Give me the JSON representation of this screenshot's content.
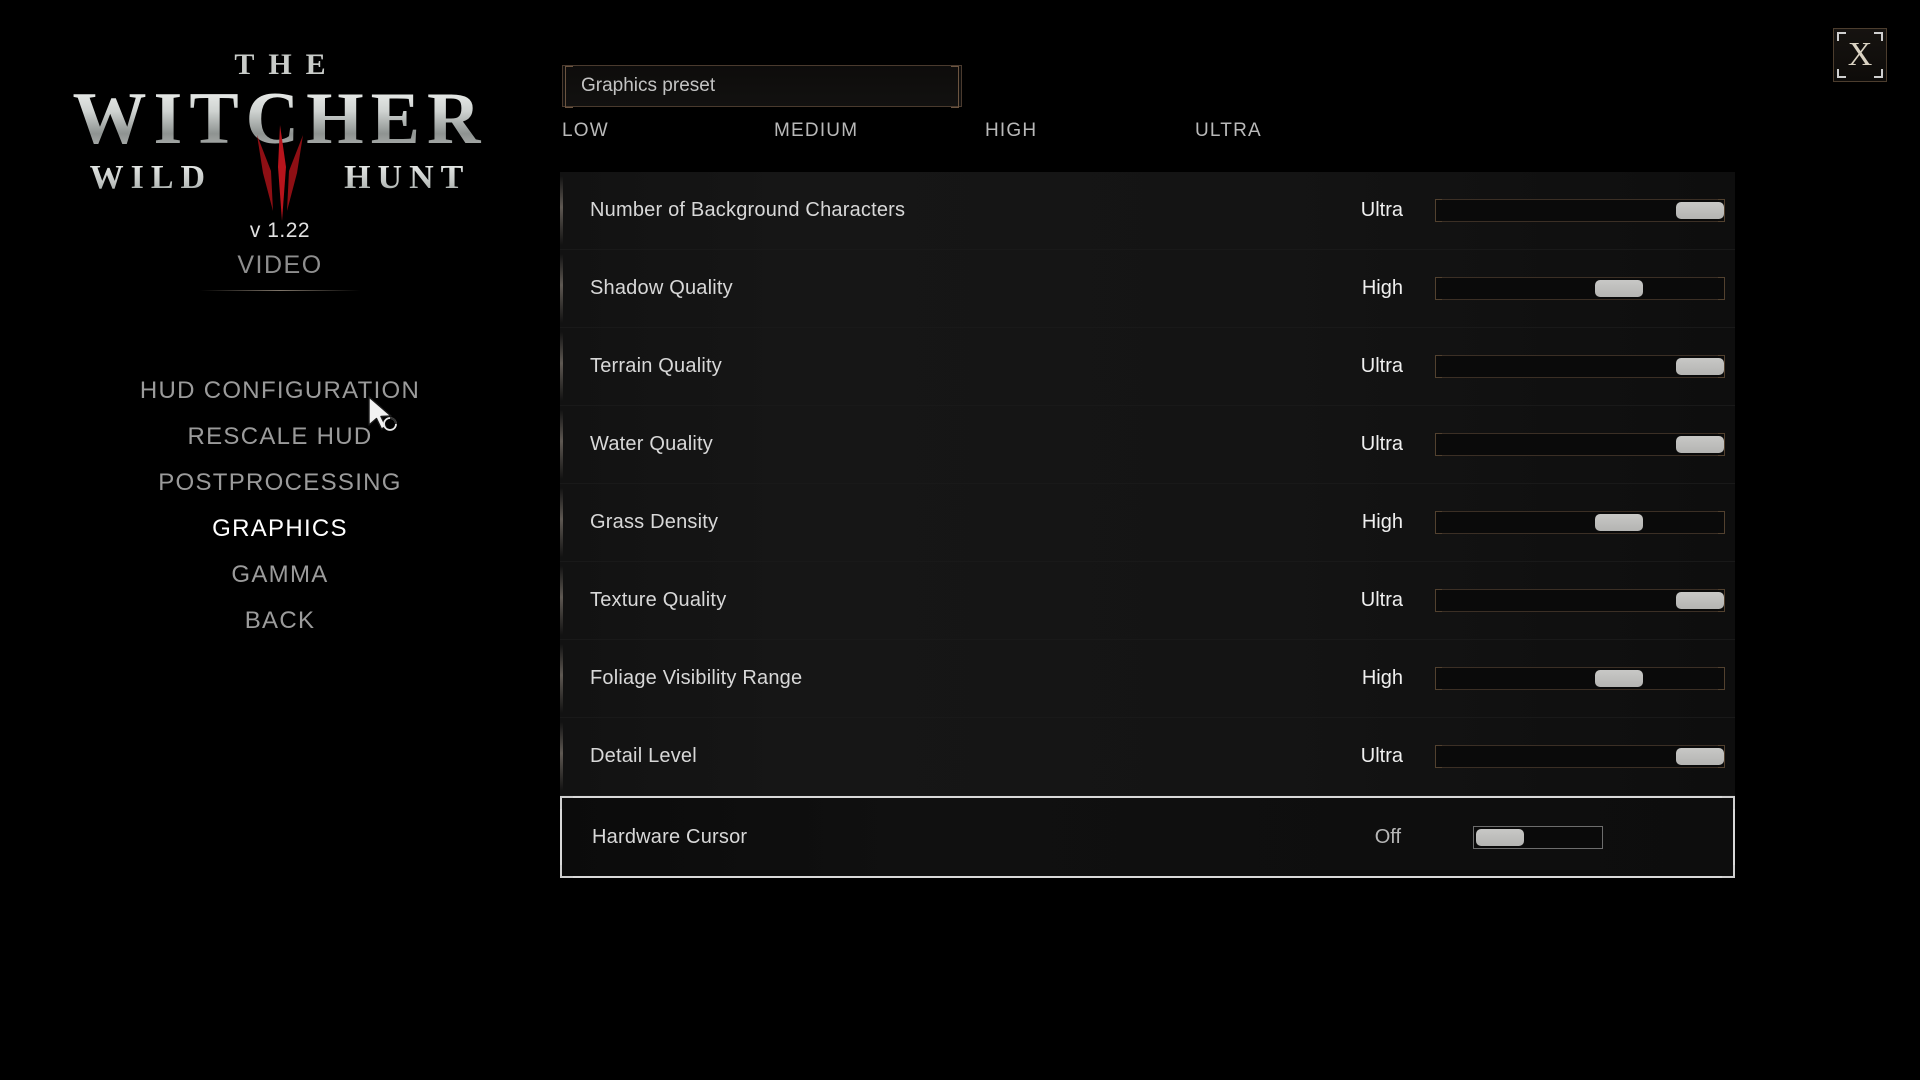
{
  "branding": {
    "title_the": "THE",
    "title_main": "WITCHER",
    "title_wild": "WILD",
    "title_hunt": "HUNT",
    "version": "v 1.22",
    "section": "VIDEO"
  },
  "menu": {
    "items": [
      {
        "label": "HUD CONFIGURATION",
        "active": false
      },
      {
        "label": "RESCALE HUD",
        "active": false
      },
      {
        "label": "POSTPROCESSING",
        "active": false
      },
      {
        "label": "GRAPHICS",
        "active": true
      },
      {
        "label": "GAMMA",
        "active": false
      },
      {
        "label": "BACK",
        "active": false
      }
    ]
  },
  "preset": {
    "label": "Graphics preset",
    "options": [
      "LOW",
      "MEDIUM",
      "HIGH",
      "ULTRA"
    ]
  },
  "settings": {
    "rows": [
      {
        "name": "Number of Background Characters",
        "value": "Ultra",
        "fill": 100
      },
      {
        "name": "Shadow Quality",
        "value": "High",
        "fill": 66
      },
      {
        "name": "Terrain Quality",
        "value": "Ultra",
        "fill": 100
      },
      {
        "name": "Water Quality",
        "value": "Ultra",
        "fill": 100
      },
      {
        "name": "Grass Density",
        "value": "High",
        "fill": 66
      },
      {
        "name": "Texture Quality",
        "value": "Ultra",
        "fill": 100
      },
      {
        "name": "Foliage Visibility Range",
        "value": "High",
        "fill": 66
      },
      {
        "name": "Detail Level",
        "value": "Ultra",
        "fill": 100
      },
      {
        "name": "Hardware Cursor",
        "value": "Off",
        "fill": 0,
        "selected": true
      }
    ]
  },
  "close_button": {
    "label": "X"
  },
  "colors": {
    "accent_border": "#4a3a2e",
    "accent_bright": "#6b5440",
    "scroll_thumb": "#5a4639",
    "selected_border": "#d9d9d9",
    "knob": "#c3c3c1",
    "text_primary": "#d8d8d8",
    "text_dim": "#9b9b9b",
    "text_active": "#ffffff"
  }
}
